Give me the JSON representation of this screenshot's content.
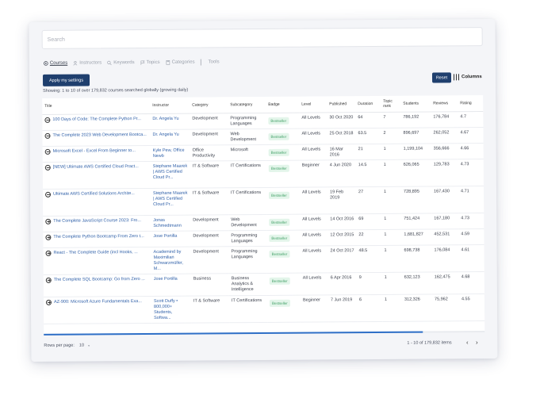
{
  "search": {
    "placeholder": "Search"
  },
  "tabs": [
    {
      "label": "Courses",
      "icon": "courses-icon",
      "active": true
    },
    {
      "label": "Instructors",
      "icon": "instructors-icon",
      "active": false
    },
    {
      "label": "Keywords",
      "icon": "keywords-icon",
      "active": false
    },
    {
      "label": "Topics",
      "icon": "topics-icon",
      "active": false
    },
    {
      "label": "Categories",
      "icon": "categories-icon",
      "active": false
    },
    {
      "label": "Tools",
      "icon": "",
      "active": false
    }
  ],
  "toolbar": {
    "apply_label": "Apply my settings",
    "reset_label": "Reset",
    "columns_label": "Columns",
    "showing": "Showing: 1 to 10 of over 179,832 courses searched globally (growing daily)"
  },
  "table": {
    "headers": [
      "Title",
      "Instructor",
      "Category",
      "Subcategory",
      "Badge",
      "Level",
      "Published",
      "Duration",
      "Topic rank",
      "Students",
      "Reviews",
      "Rating"
    ],
    "rows": [
      {
        "toggle": "minus",
        "title": "100 Days of Code: The Complete Python Pr...",
        "instructor": "Dr. Angela Yu",
        "category": "Development",
        "subcategory": "Programming Languages",
        "badge": "Bestseller",
        "level": "All Levels",
        "published": "30 Oct 2020",
        "duration": "64",
        "rank": "7",
        "students": "786,192",
        "reviews": "176,784",
        "rating": "4.7"
      },
      {
        "toggle": "minus",
        "title": "The Complete 2023 Web Development Bootca...",
        "instructor": "Dr. Angela Yu",
        "category": "Development",
        "subcategory": "Web Development",
        "badge": "Bestseller",
        "level": "All Levels",
        "published": "25 Oct 2018",
        "duration": "63.5",
        "rank": "2",
        "students": "896,697",
        "reviews": "262,052",
        "rating": "4.67"
      },
      {
        "toggle": "minus",
        "title": "Microsoft Excel - Excel From Beginner to...",
        "instructor": "Kyle Pew, Office Newb",
        "category": "Office Productivity",
        "subcategory": "Microsoft",
        "badge": "Bestseller",
        "level": "All Levels",
        "published": "16 Mar 2016",
        "duration": "21",
        "rank": "1",
        "students": "1,199,104",
        "reviews": "356,666",
        "rating": "4.66"
      },
      {
        "toggle": "minus",
        "title": "[NEW] Ultimate AWS Certified Cloud Pract...",
        "instructor": "Stephane Maarek | AWS Certified Cloud Pr...",
        "category": "IT & Software",
        "subcategory": "IT Certifications",
        "badge": "Bestseller",
        "level": "Beginner",
        "published": "4 Jun 2020",
        "duration": "14.5",
        "rank": "1",
        "students": "626,065",
        "reviews": "129,783",
        "rating": "4.73"
      },
      {
        "toggle": "minus",
        "title": "Ultimate AWS Certified Solutions Archite...",
        "instructor": "Stephane Maarek | AWS Certified Cloud Pr...",
        "category": "IT & Software",
        "subcategory": "IT Certifications",
        "badge": "Bestseller",
        "level": "All Levels",
        "published": "19 Feb 2019",
        "duration": "27",
        "rank": "1",
        "students": "728,895",
        "reviews": "167,430",
        "rating": "4.71"
      },
      {
        "toggle": "plus",
        "title": "The Complete JavaScript Course 2023: Fro...",
        "instructor": "Jonas Schmedtmann",
        "category": "Development",
        "subcategory": "Web Development",
        "badge": "Bestseller",
        "level": "All Levels",
        "published": "14 Oct 2016",
        "duration": "69",
        "rank": "1",
        "students": "751,424",
        "reviews": "167,180",
        "rating": "4.73"
      },
      {
        "toggle": "plus",
        "title": "The Complete Python Bootcamp From Zero t...",
        "instructor": "Jose Portilla",
        "category": "Development",
        "subcategory": "Programming Languages",
        "badge": "Bestseller",
        "level": "All Levels",
        "published": "12 Oct 2015",
        "duration": "22",
        "rank": "1",
        "students": "1,681,827",
        "reviews": "452,531",
        "rating": "4.59"
      },
      {
        "toggle": "plus",
        "title": "React - The Complete Guide (incl Hooks, ...",
        "instructor": "Academind by Maximilian Schwarzmüller, M...",
        "category": "Development",
        "subcategory": "Programming Languages",
        "badge": "Bestseller",
        "level": "All Levels",
        "published": "24 Oct 2017",
        "duration": "48.5",
        "rank": "1",
        "students": "698,738",
        "reviews": "176,084",
        "rating": "4.61"
      },
      {
        "toggle": "plus",
        "title": "The Complete SQL Bootcamp: Go from Zero ...",
        "instructor": "Jose Portilla",
        "category": "Business",
        "subcategory": "Business Analytics & Intelligence",
        "badge": "Bestseller",
        "level": "All Levels",
        "published": "6 Apr 2016",
        "duration": "9",
        "rank": "1",
        "students": "632,123",
        "reviews": "162,475",
        "rating": "4.68"
      },
      {
        "toggle": "plus",
        "title": "AZ-900: Microsoft Azure Fundamentals Exa...",
        "instructor": "Scott Duffy • 800,000+ Students, Softwa...",
        "category": "IT & Software",
        "subcategory": "IT Certifications",
        "badge": "Bestseller",
        "level": "Beginner",
        "published": "7 Jun 2019",
        "duration": "6",
        "rank": "1",
        "students": "312,326",
        "reviews": "75,962",
        "rating": "4.55"
      }
    ]
  },
  "pagination": {
    "rows_per_page_label": "Rows per page:",
    "rows_per_page": "10",
    "range": "1 - 10 of 179,832 items",
    "prev": "‹",
    "next": "›"
  },
  "progress": 0.86,
  "colors": {
    "primary": "#1f3f6e",
    "link": "#2e5fa8",
    "badge_bg": "#e3f5ea",
    "badge_text": "#3c9d62"
  }
}
